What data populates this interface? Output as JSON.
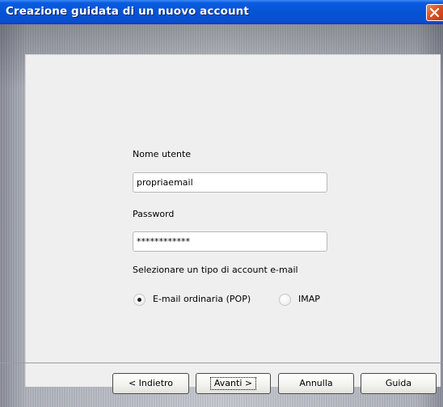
{
  "window": {
    "title": "Creazione guidata di un nuovo account",
    "close_icon": "close-icon"
  },
  "form": {
    "username_label": "Nome utente",
    "username_value": "propriaemail",
    "password_label": "Password",
    "password_value": "************",
    "account_type_label": "Selezionare un tipo di account e-mail",
    "account_types": [
      {
        "label": "E-mail ordinaria (POP)",
        "selected": true
      },
      {
        "label": "IMAP",
        "selected": false
      }
    ]
  },
  "buttons": {
    "back": "< Indietro",
    "next": "Avanti >",
    "cancel": "Annulla",
    "help": "Guida"
  },
  "colors": {
    "titlebar": "#0553d4",
    "close_button": "#e0501f",
    "panel": "#efefef"
  }
}
